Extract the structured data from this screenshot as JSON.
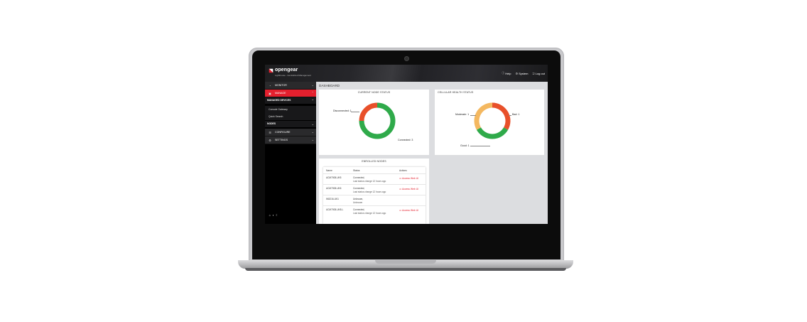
{
  "brand": {
    "name": "opengear",
    "tagline": "Lighthouse - Centralized Management"
  },
  "topnav": [
    {
      "label": "Help",
      "icon": "help-circle-icon"
    },
    {
      "label": "System",
      "icon": "system-gear-icon"
    },
    {
      "label": "Log out",
      "icon": "log-out-icon"
    }
  ],
  "sidebar": {
    "monitor": "MONITOR",
    "manage": "MANAGE",
    "managed_devices": "MANAGED DEVICES",
    "console_gateway": "Console Gateway",
    "quick_search": "Quick Search",
    "nodes": "NODES",
    "configure": "CONFIGURE",
    "settings": "SETTINGS"
  },
  "page_title": "DASHBOARD",
  "node_status": {
    "title": "CURRENT NODE STATUS",
    "label_disconnected": "Disconnected: 1",
    "label_connected": "Connected: 3",
    "chart_data": {
      "type": "pie",
      "donut": true,
      "title": "CURRENT NODE STATUS",
      "slices": [
        {
          "name": "Connected",
          "value": 3,
          "color": "#2faa4a"
        },
        {
          "name": "Disconnected",
          "value": 1,
          "color": "#e8502a"
        }
      ]
    }
  },
  "cellular_health": {
    "title": "CELLULAR HEALTH STATUS",
    "label_moderate": "Moderate: 1",
    "label_bad": "Bad: 1",
    "label_good": "Good: 1",
    "chart_data": {
      "type": "pie",
      "donut": true,
      "title": "CELLULAR HEALTH STATUS",
      "slices": [
        {
          "name": "Bad",
          "value": 1,
          "color": "#e8502a"
        },
        {
          "name": "Good",
          "value": 1,
          "color": "#2faa4a"
        },
        {
          "name": "Moderate",
          "value": 1,
          "color": "#f4b860"
        }
      ]
    }
  },
  "enrolled_nodes": {
    "title": "ENROLLED NODES",
    "columns": [
      "Name",
      "Status",
      "Actions"
    ],
    "rows": [
      {
        "name": "ACM7008-UK5",
        "status": "Connected,",
        "detail": "Last status change 12 hours ago",
        "action": "Access Web UI"
      },
      {
        "name": "ACM7008-UK6",
        "status": "Connected,",
        "detail": "Last status change 12 hours ago",
        "action": "Access Web UI"
      },
      {
        "name": "IM3216-UK1",
        "status": "Unknown,",
        "detail": "Unknown",
        "action": ""
      },
      {
        "name": "ACM7008-UK8-L",
        "status": "Connected,",
        "detail": "Last status change 12 hours ago",
        "action": "Access Web UI"
      }
    ]
  },
  "colors": {
    "accent": "#e4202e",
    "connected": "#2faa4a",
    "bad": "#e8502a",
    "moderate": "#f4b860"
  }
}
